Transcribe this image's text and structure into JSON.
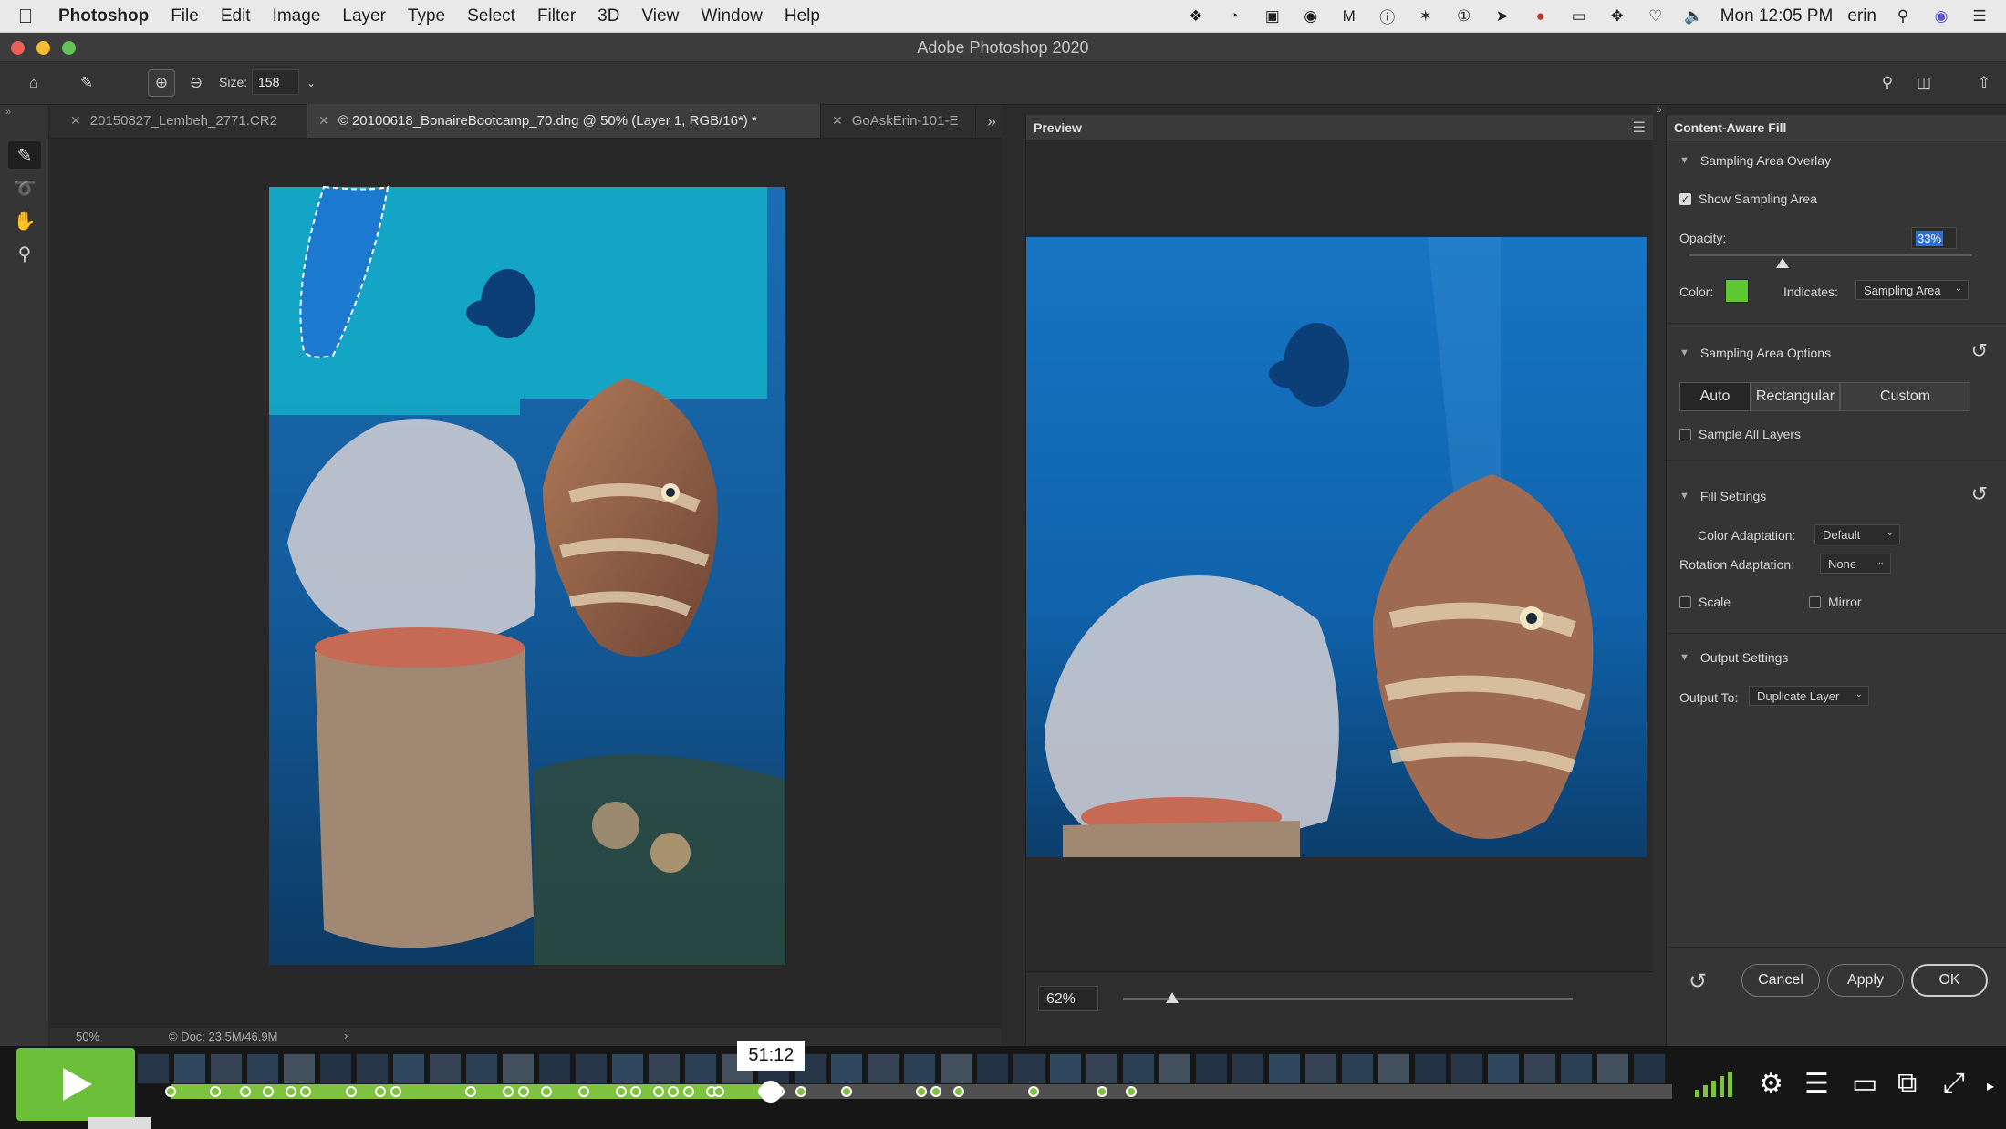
{
  "menubar": {
    "app_name": "Photoshop",
    "items": [
      "File",
      "Edit",
      "Image",
      "Layer",
      "Type",
      "Select",
      "Filter",
      "3D",
      "View",
      "Window",
      "Help"
    ],
    "clock": "Mon 12:05 PM",
    "user": "erin"
  },
  "window": {
    "title": "Adobe Photoshop 2020"
  },
  "options_bar": {
    "size_label": "Size:",
    "size_value": "158"
  },
  "tabs": [
    {
      "label": "20150827_Lembeh_2771.CR2",
      "active": false
    },
    {
      "label": "© 20100618_BonaireBootcamp_70.dng @ 50% (Layer 1, RGB/16*) *",
      "active": true
    },
    {
      "label": "GoAskErin-101-E",
      "active": false
    }
  ],
  "doc_status": {
    "zoom": "50%",
    "doc_size": "© Doc: 23.5M/46.9M"
  },
  "preview": {
    "title": "Preview",
    "zoom": "62%",
    "zoom_level": 0.11
  },
  "caf": {
    "title": "Content-Aware Fill",
    "overlay": {
      "section": "Sampling Area Overlay",
      "show_label": "Show Sampling Area",
      "show_checked": true,
      "opacity_label": "Opacity:",
      "opacity_value": "33%",
      "opacity_level": 0.33,
      "color_label": "Color:",
      "color": "#5ec832",
      "indicates_label": "Indicates:",
      "indicates_value": "Sampling Area"
    },
    "options": {
      "section": "Sampling Area Options",
      "modes": [
        "Auto",
        "Rectangular",
        "Custom"
      ],
      "active_mode": "Auto",
      "sample_all_label": "Sample All Layers"
    },
    "fill": {
      "section": "Fill Settings",
      "color_adapt_label": "Color Adaptation:",
      "color_adapt_value": "Default",
      "rotation_label": "Rotation Adaptation:",
      "rotation_value": "None",
      "scale_label": "Scale",
      "mirror_label": "Mirror"
    },
    "output": {
      "section": "Output Settings",
      "output_label": "Output To:",
      "output_value": "Duplicate Layer"
    },
    "buttons": {
      "cancel": "Cancel",
      "apply": "Apply",
      "ok": "OK"
    }
  },
  "player": {
    "timecode": "51:12",
    "progress": 0.4,
    "accent": "#7ec23e"
  }
}
